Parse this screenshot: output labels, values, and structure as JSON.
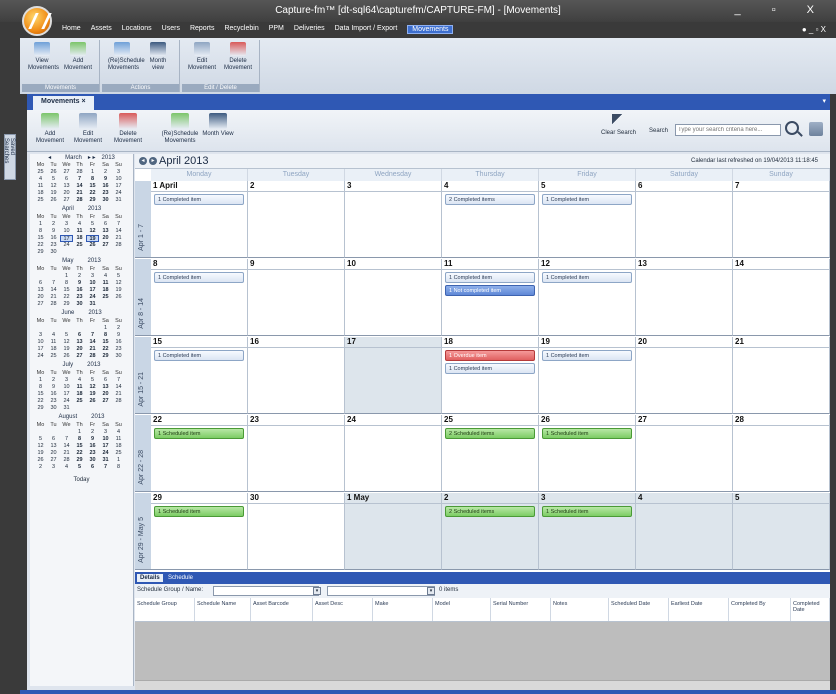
{
  "window": {
    "title": "Capture-fm™  [dt-sql64\\capturefm/CAPTURE-FM] - [Movements]",
    "controls": "_ ▫ X"
  },
  "menu": {
    "items": [
      "Home",
      "Assets",
      "Locations",
      "Users",
      "Reports",
      "Recyclebin",
      "PPM",
      "Deliveries",
      "Data Import / Export",
      "Movements"
    ],
    "right": "● _ ▫ X"
  },
  "ribbon": {
    "groups": [
      {
        "label": "Movements",
        "buttons": [
          "View Movements",
          "Add Movement"
        ]
      },
      {
        "label": "Actions",
        "buttons": [
          "(Re)Schedule Movements",
          "Month view"
        ]
      },
      {
        "label": "Edit / Delete",
        "buttons": [
          "Edit Movement",
          "Delete Movement"
        ]
      }
    ]
  },
  "side_tab": "Saved Searches",
  "doc_tab": {
    "label": "Movements",
    "close": "×"
  },
  "toolbar": {
    "buttons": [
      "Add Movement",
      "Edit Movement",
      "Delete Movement",
      "(Re)Schedule Movements",
      "Month View"
    ],
    "clear_search": "Clear Search",
    "search_label": "Search",
    "search_placeholder": "Type your search criteria here..."
  },
  "minicals": [
    {
      "title": "March",
      "nav_left": "◂",
      "nav_right": "▸ ▸",
      "year": "2013",
      "weeks": [
        [
          "25",
          "26",
          "27",
          "28",
          "1",
          "2",
          "3"
        ],
        [
          "4",
          "5",
          "6",
          "7",
          "8",
          "9",
          "10"
        ],
        [
          "11",
          "12",
          "13",
          "14",
          "15",
          "16",
          "17"
        ],
        [
          "18",
          "19",
          "20",
          "21",
          "22",
          "23",
          "24"
        ],
        [
          "25",
          "26",
          "27",
          "28",
          "29",
          "30",
          "31"
        ]
      ]
    },
    {
      "title": "April",
      "year": "2013",
      "weeks": [
        [
          "1",
          "2",
          "3",
          "4",
          "5",
          "6",
          "7"
        ],
        [
          "8",
          "9",
          "10",
          "11",
          "12",
          "13",
          "14"
        ],
        [
          "15",
          "16",
          "17",
          "18",
          "19",
          "20",
          "21"
        ],
        [
          "22",
          "23",
          "24",
          "25",
          "26",
          "27",
          "28"
        ],
        [
          "29",
          "30",
          "",
          "",
          "",
          "",
          ""
        ]
      ]
    },
    {
      "title": "May",
      "year": "2013",
      "weeks": [
        [
          "",
          "",
          "1",
          "2",
          "3",
          "4",
          "5"
        ],
        [
          "6",
          "7",
          "8",
          "9",
          "10",
          "11",
          "12"
        ],
        [
          "13",
          "14",
          "15",
          "16",
          "17",
          "18",
          "19"
        ],
        [
          "20",
          "21",
          "22",
          "23",
          "24",
          "25",
          "26"
        ],
        [
          "27",
          "28",
          "29",
          "30",
          "31",
          "",
          ""
        ]
      ]
    },
    {
      "title": "June",
      "year": "2013",
      "weeks": [
        [
          "",
          "",
          "",
          "",
          "",
          "1",
          "2"
        ],
        [
          "3",
          "4",
          "5",
          "6",
          "7",
          "8",
          "9"
        ],
        [
          "10",
          "11",
          "12",
          "13",
          "14",
          "15",
          "16"
        ],
        [
          "17",
          "18",
          "19",
          "20",
          "21",
          "22",
          "23"
        ],
        [
          "24",
          "25",
          "26",
          "27",
          "28",
          "29",
          "30"
        ]
      ]
    },
    {
      "title": "July",
      "year": "2013",
      "weeks": [
        [
          "1",
          "2",
          "3",
          "4",
          "5",
          "6",
          "7"
        ],
        [
          "8",
          "9",
          "10",
          "11",
          "12",
          "13",
          "14"
        ],
        [
          "15",
          "16",
          "17",
          "18",
          "19",
          "20",
          "21"
        ],
        [
          "22",
          "23",
          "24",
          "25",
          "26",
          "27",
          "28"
        ],
        [
          "29",
          "30",
          "31",
          "",
          "",
          "",
          ""
        ]
      ]
    },
    {
      "title": "August",
      "year": "2013",
      "weeks": [
        [
          "",
          "",
          "",
          "1",
          "2",
          "3",
          "4"
        ],
        [
          "5",
          "6",
          "7",
          "8",
          "9",
          "10",
          "11"
        ],
        [
          "12",
          "13",
          "14",
          "15",
          "16",
          "17",
          "18"
        ],
        [
          "19",
          "20",
          "21",
          "22",
          "23",
          "24",
          "25"
        ],
        [
          "26",
          "27",
          "28",
          "29",
          "30",
          "31",
          "1"
        ],
        [
          "2",
          "3",
          "4",
          "5",
          "6",
          "7",
          "8"
        ]
      ]
    }
  ],
  "minical_days": [
    "Mo",
    "Tu",
    "We",
    "Th",
    "Fr",
    "Sa",
    "Su"
  ],
  "minical_today": "Today",
  "calendar": {
    "title": "April 2013",
    "refreshed": "Calendar last refreshed on 19/04/2013 11:18:45",
    "days": [
      "Monday",
      "Tuesday",
      "Wednesday",
      "Thursday",
      "Friday",
      "Saturday",
      "Sunday"
    ],
    "weeks": [
      {
        "label": "Apr 1 - 7",
        "cells": [
          {
            "d": "1 April",
            "e": [
              [
                "1 Completed item",
                ""
              ]
            ]
          },
          {
            "d": "2",
            "e": []
          },
          {
            "d": "3",
            "e": []
          },
          {
            "d": "4",
            "e": [
              [
                "2 Completed items",
                ""
              ]
            ]
          },
          {
            "d": "5",
            "e": [
              [
                "1 Completed item",
                ""
              ]
            ]
          },
          {
            "d": "6",
            "e": []
          },
          {
            "d": "7",
            "e": []
          }
        ]
      },
      {
        "label": "Apr 8 - 14",
        "cells": [
          {
            "d": "8",
            "e": [
              [
                "1 Completed item",
                ""
              ]
            ]
          },
          {
            "d": "9",
            "e": []
          },
          {
            "d": "10",
            "e": []
          },
          {
            "d": "11",
            "e": [
              [
                "1 Completed item",
                ""
              ],
              [
                "1 Not completed item",
                "blue"
              ]
            ]
          },
          {
            "d": "12",
            "e": [
              [
                "1 Completed item",
                ""
              ]
            ]
          },
          {
            "d": "13",
            "e": []
          },
          {
            "d": "14",
            "e": []
          }
        ]
      },
      {
        "label": "Apr 15 - 21",
        "cells": [
          {
            "d": "15",
            "e": [
              [
                "1 Completed item",
                ""
              ]
            ]
          },
          {
            "d": "16",
            "e": []
          },
          {
            "d": "17",
            "e": [],
            "off": true
          },
          {
            "d": "18",
            "e": [
              [
                "1 Overdue item",
                "red"
              ],
              [
                "1 Completed item",
                ""
              ]
            ]
          },
          {
            "d": "19",
            "e": [
              [
                "1 Completed item",
                ""
              ]
            ]
          },
          {
            "d": "20",
            "e": []
          },
          {
            "d": "21",
            "e": []
          }
        ]
      },
      {
        "label": "Apr 22 - 28",
        "cells": [
          {
            "d": "22",
            "e": [
              [
                "1 Scheduled item",
                "green"
              ]
            ]
          },
          {
            "d": "23",
            "e": []
          },
          {
            "d": "24",
            "e": []
          },
          {
            "d": "25",
            "e": [
              [
                "2 Scheduled items",
                "green"
              ]
            ]
          },
          {
            "d": "26",
            "e": [
              [
                "1 Scheduled item",
                "green"
              ]
            ]
          },
          {
            "d": "27",
            "e": []
          },
          {
            "d": "28",
            "e": []
          }
        ]
      },
      {
        "label": "Apr 29 - May 5",
        "cells": [
          {
            "d": "29",
            "e": [
              [
                "1 Scheduled item",
                "green"
              ]
            ]
          },
          {
            "d": "30",
            "e": []
          },
          {
            "d": "1 May",
            "e": [],
            "off": true
          },
          {
            "d": "2",
            "e": [
              [
                "2 Scheduled items",
                "green"
              ]
            ],
            "off": true
          },
          {
            "d": "3",
            "e": [
              [
                "1 Scheduled item",
                "green"
              ]
            ],
            "off": true
          },
          {
            "d": "4",
            "e": [],
            "off": true
          },
          {
            "d": "5",
            "e": [],
            "off": true
          }
        ]
      }
    ]
  },
  "details": {
    "tabs": [
      "Details",
      "Schedule"
    ],
    "filter_label": "Schedule Group / Name:",
    "items_count": "0 items",
    "columns": [
      "Schedule Group",
      "Schedule Name",
      "Asset Barcode",
      "Asset Desc",
      "Make",
      "Model",
      "Serial Number",
      "Notes",
      "Scheduled Date",
      "Earliest Date",
      "Completed By",
      "Completed Date"
    ]
  },
  "colors": {
    "accent": "#2f58b4",
    "overdue": "#e06060",
    "scheduled": "#7ccc64",
    "not_completed": "#5f88d6"
  }
}
